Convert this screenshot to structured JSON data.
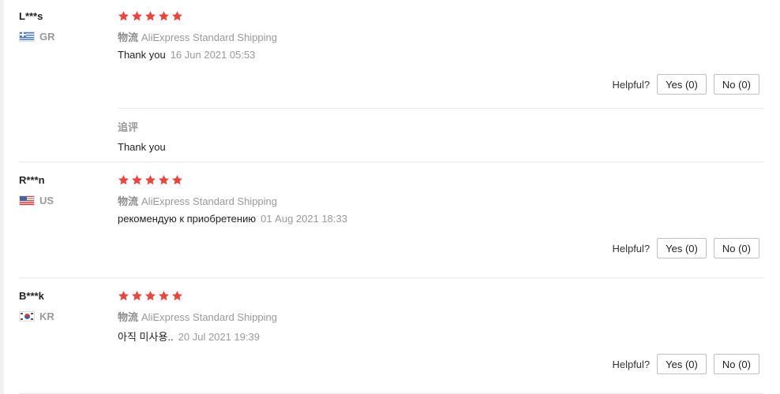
{
  "helpful": {
    "label": "Helpful?",
    "yes_label": "Yes (0)",
    "no_label": "No (0)"
  },
  "star_color": "#e8473f",
  "reviews": [
    {
      "user": "L***s",
      "country": "GR",
      "flag_icon": "greece-flag-icon",
      "rating": 5,
      "shipping_label": "物流",
      "shipping_method": "AliExpress Standard Shipping",
      "text": "Thank you",
      "date": "16 Jun 2021 05:53",
      "followup_label": "追评",
      "followup_text": "Thank you"
    },
    {
      "user": "R***n",
      "country": "US",
      "flag_icon": "us-flag-icon",
      "rating": 5,
      "shipping_label": "物流",
      "shipping_method": "AliExpress Standard Shipping",
      "text": "рекомендую к приобретению",
      "date": "01 Aug 2021 18:33"
    },
    {
      "user": "B***k",
      "country": "KR",
      "flag_icon": "south-korea-flag-icon",
      "rating": 5,
      "shipping_label": "物流",
      "shipping_method": "AliExpress Standard Shipping",
      "text": "아직 미사용..",
      "date": "20 Jul 2021 19:39"
    }
  ]
}
